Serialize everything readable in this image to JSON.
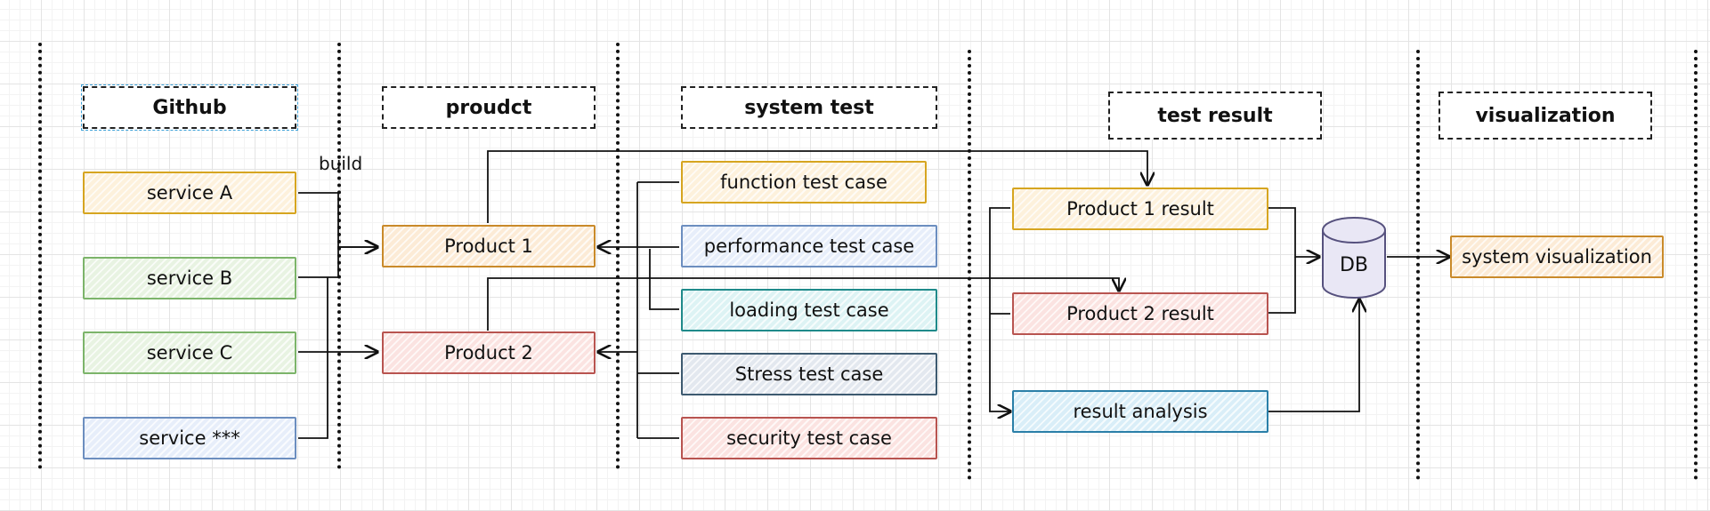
{
  "lanes": [
    {
      "header": "Github"
    },
    {
      "header": "proudct"
    },
    {
      "header": "system test"
    },
    {
      "header": "test result"
    },
    {
      "header": "visualization"
    }
  ],
  "github": {
    "services": [
      "service A",
      "service B",
      "service C",
      "service ***"
    ]
  },
  "build_label": "build",
  "products": [
    "Product 1",
    "Product 2"
  ],
  "test_cases": [
    "function test case",
    "performance test case",
    "loading test case",
    "Stress test case",
    "security test case"
  ],
  "results": {
    "product1": "Product 1 result",
    "product2": "Product 2 result",
    "analysis": "result analysis"
  },
  "db_label": "DB",
  "visualization_node": "system visualization",
  "colors": {
    "yellow_stroke": "#d6a520",
    "yellow_fill": "#fdf1dc",
    "green_stroke": "#7cb46a",
    "green_fill": "#e8f3e2",
    "blue_stroke": "#6c8ebf",
    "blue_fill": "#e7eefa",
    "orange_stroke": "#c98a2a",
    "orange_fill": "#fcebd6",
    "red_stroke": "#b85450",
    "red_fill": "#fbe3e1",
    "teal_stroke": "#1f8a8a",
    "teal_fill": "#ddf3f4",
    "slate_stroke": "#3d5a70",
    "slate_fill": "#e3e8ef",
    "cyan_stroke": "#2a7fa8",
    "cyan_fill": "#d9eef8",
    "db_stroke": "#56517e",
    "db_fill": "#e9e7f5"
  }
}
